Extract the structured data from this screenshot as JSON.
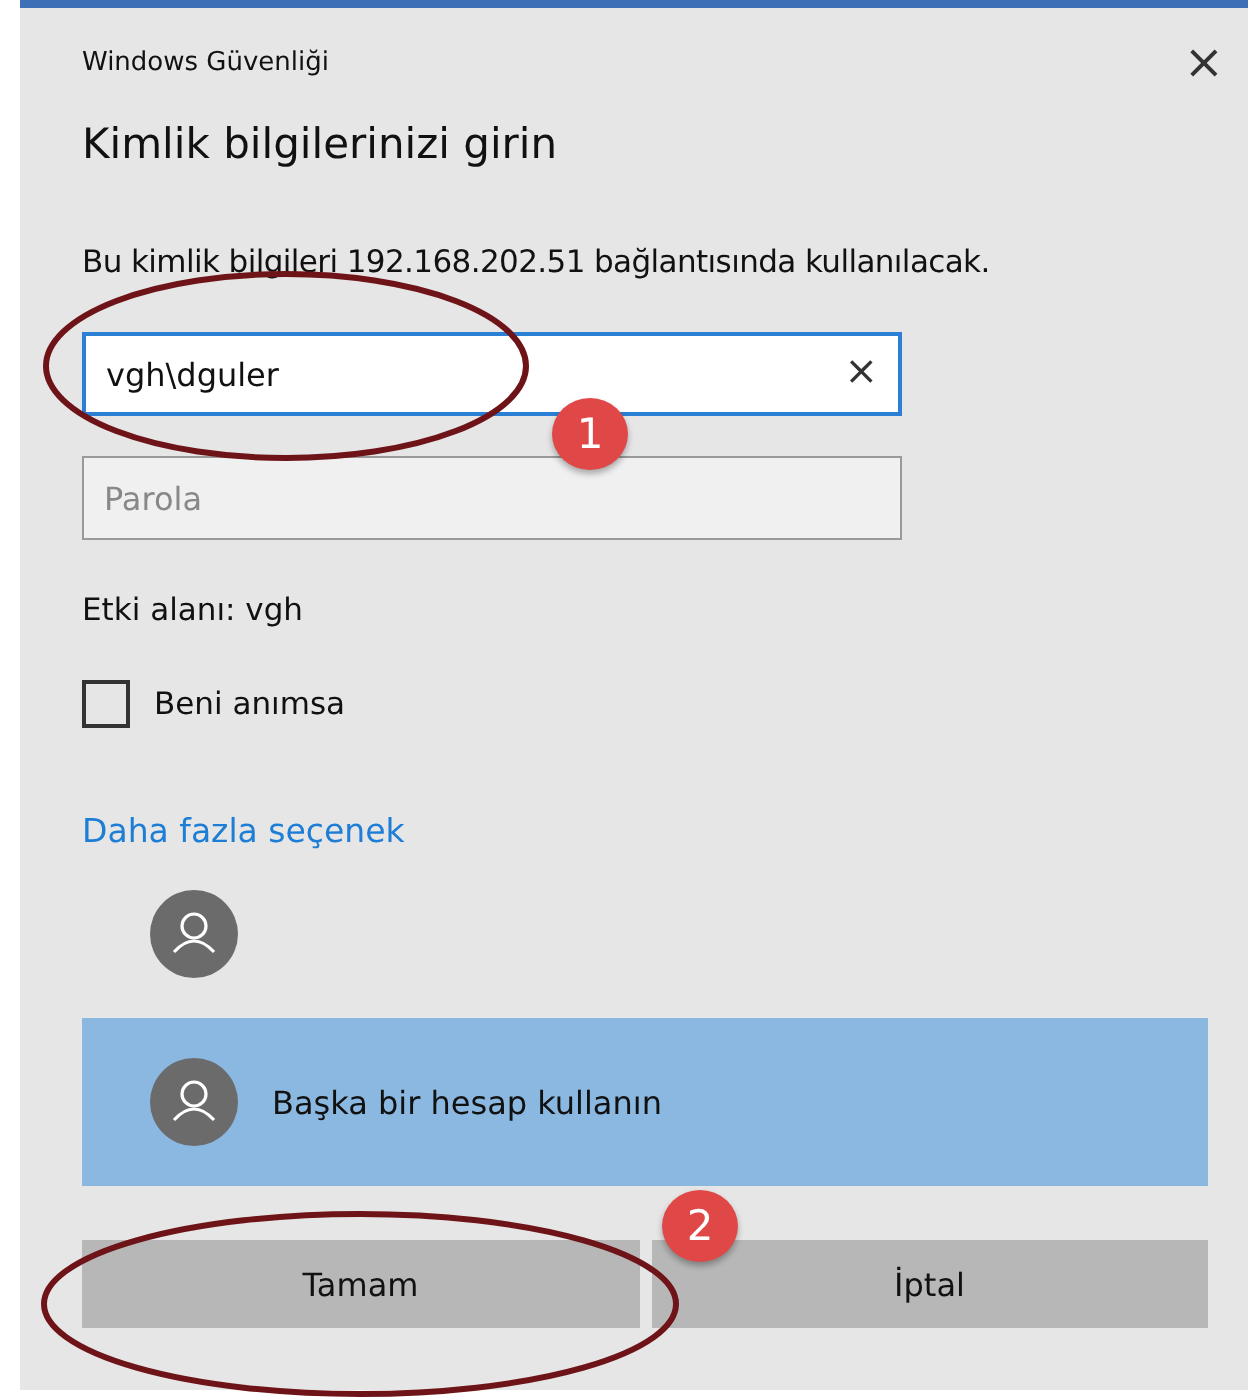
{
  "window": {
    "title": "Windows Güvenliği",
    "close": "×"
  },
  "heading": "Kimlik bilgilerinizi girin",
  "description": "Bu kimlik bilgileri 192.168.202.51 bağlantısında kullanılacak.",
  "username": {
    "value": "vgh\\dguler",
    "clear": "×",
    "focused": true
  },
  "password": {
    "placeholder": "Parola"
  },
  "domain": "Etki alanı: vgh",
  "remember": {
    "label": "Beni anımsa",
    "checked": false
  },
  "more_link": "Daha fazla seçenek",
  "accounts": [
    {
      "selected": false
    },
    {
      "label": "Başka bir hesap kullanın",
      "selected": true
    }
  ],
  "buttons": [
    "Tamam",
    "İptal"
  ],
  "annotations": [
    {
      "number": "1"
    },
    {
      "number": "2"
    }
  ]
}
